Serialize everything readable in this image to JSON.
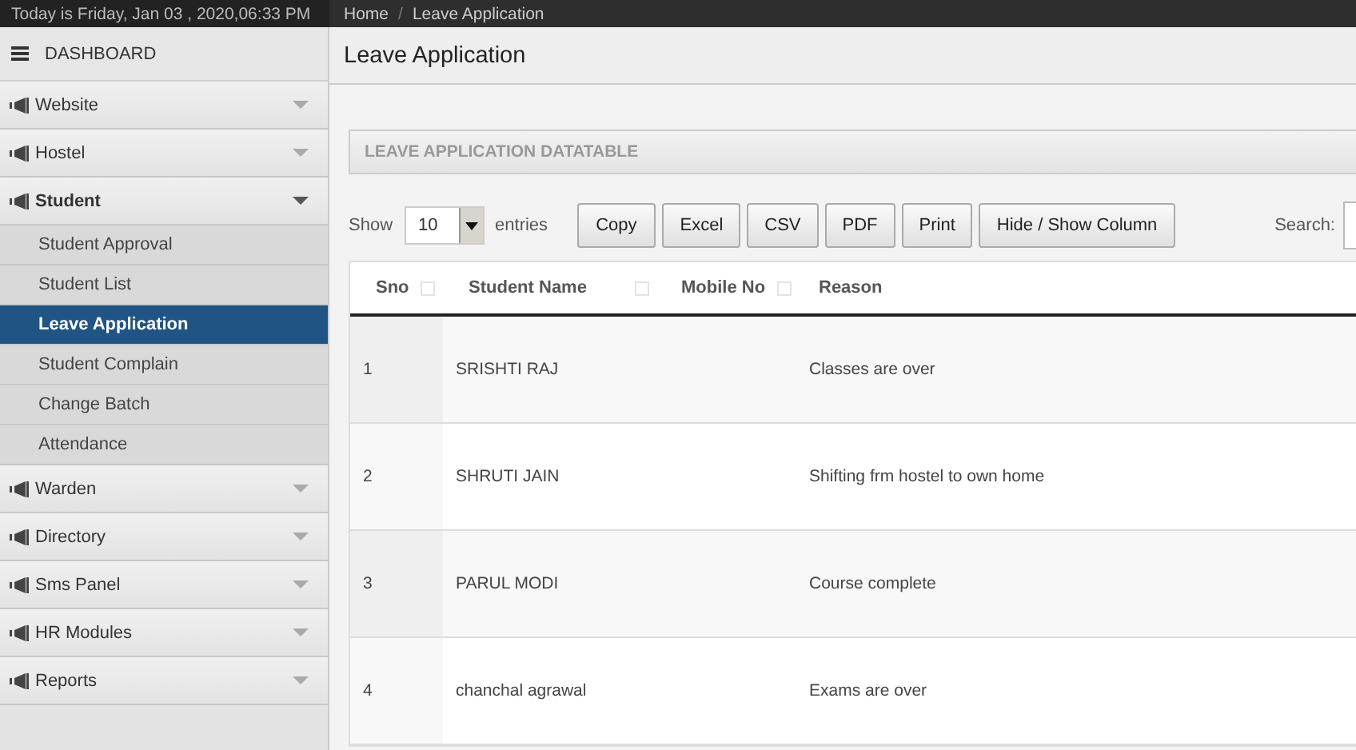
{
  "top_bar": {
    "date_text": "Today is Friday, Jan 03 , 2020,06:33 PM",
    "breadcrumb": [
      "Home",
      "Leave Application"
    ],
    "breadcrumb_separator": "/"
  },
  "sidebar": {
    "dashboard": "DASHBOARD",
    "items": [
      {
        "label": "Website",
        "expanded": false
      },
      {
        "label": "Hostel",
        "expanded": false
      },
      {
        "label": "Student",
        "expanded": true,
        "children": [
          {
            "label": "Student Approval",
            "selected": false
          },
          {
            "label": "Student List",
            "selected": false
          },
          {
            "label": "Leave Application",
            "selected": true
          },
          {
            "label": "Student Complain",
            "selected": false
          },
          {
            "label": "Change Batch",
            "selected": false
          },
          {
            "label": "Attendance",
            "selected": false
          }
        ]
      },
      {
        "label": "Warden",
        "expanded": false
      },
      {
        "label": "Directory",
        "expanded": false
      },
      {
        "label": "Sms Panel",
        "expanded": false
      },
      {
        "label": "HR Modules",
        "expanded": false
      },
      {
        "label": "Reports",
        "expanded": false
      }
    ]
  },
  "page_title": "Leave Application",
  "panel": {
    "title": "LEAVE APPLICATION DATATABLE",
    "show_label": "Show",
    "page_size": "10",
    "entries_label": "entries",
    "buttons": [
      "Copy",
      "Excel",
      "CSV",
      "PDF",
      "Print",
      "Hide / Show Column"
    ],
    "search_label": "Search:",
    "table": {
      "columns": [
        {
          "label": "Sno",
          "sortable": true
        },
        {
          "label": "Student Name",
          "sortable": true
        },
        {
          "label": "Mobile No",
          "sortable": true
        },
        {
          "label": "Reason",
          "sortable": false
        }
      ],
      "rows": [
        [
          "1",
          "SRISHTI RAJ",
          "",
          "Classes are over"
        ],
        [
          "2",
          "SHRUTI JAIN",
          "",
          "Shifting frm hostel to own home"
        ],
        [
          "3",
          "PARUL MODI",
          "",
          "Course complete"
        ],
        [
          "4",
          "chanchal agrawal",
          "",
          "Exams are over"
        ]
      ]
    }
  }
}
